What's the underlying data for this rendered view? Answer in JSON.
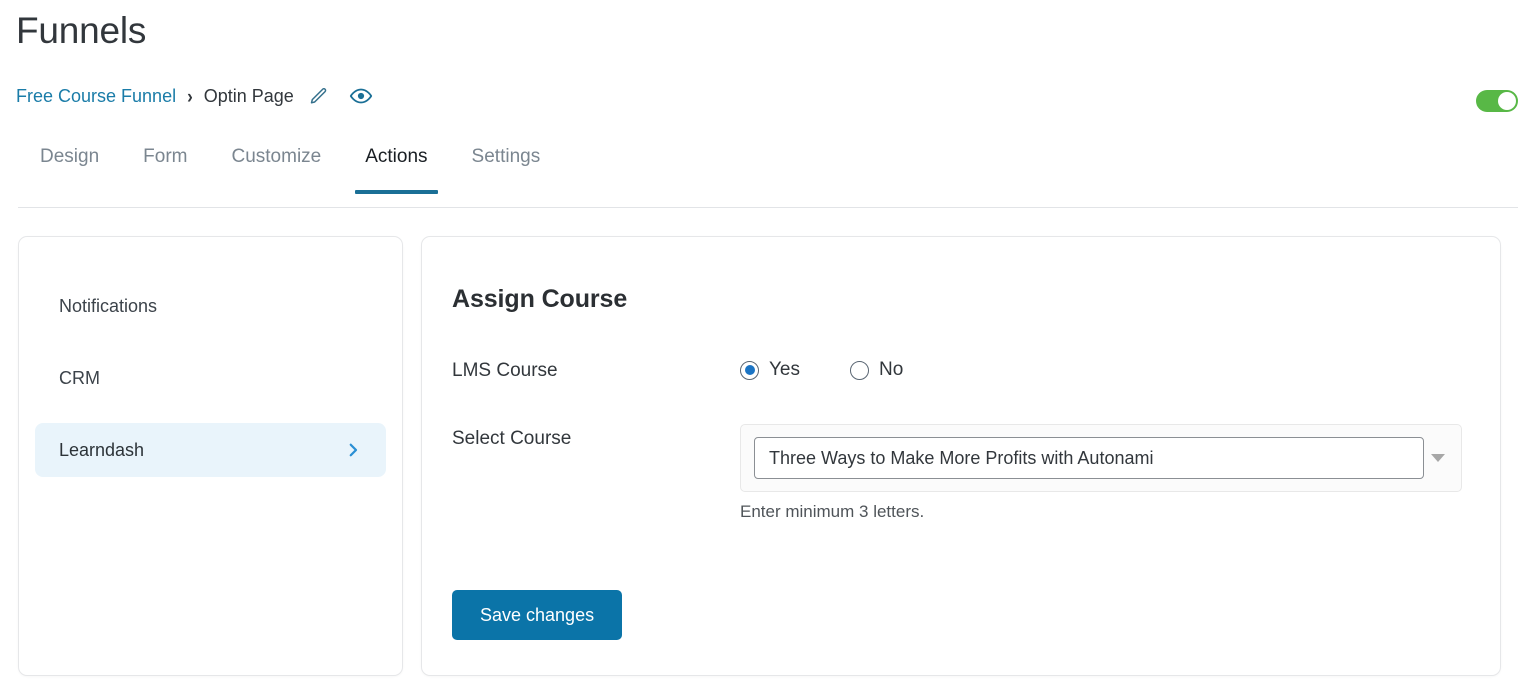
{
  "header": {
    "title": "Funnels",
    "breadcrumb": {
      "parent": "Free Course Funnel",
      "separator": "›",
      "current": "Optin Page",
      "edit_icon": "pencil-icon",
      "preview_icon": "eye-icon"
    },
    "status_toggle": {
      "state": "on",
      "color": "#58b846"
    }
  },
  "tabs": [
    {
      "label": "Design",
      "active": false
    },
    {
      "label": "Form",
      "active": false
    },
    {
      "label": "Customize",
      "active": false
    },
    {
      "label": "Actions",
      "active": true
    },
    {
      "label": "Settings",
      "active": false
    }
  ],
  "sidebar": {
    "items": [
      {
        "label": "Notifications",
        "active": false,
        "chevron": false
      },
      {
        "label": "CRM",
        "active": false,
        "chevron": false
      },
      {
        "label": "Learndash",
        "active": true,
        "chevron": true,
        "chevron_icon": "chevron-right-icon"
      }
    ]
  },
  "main": {
    "section_title": "Assign Course",
    "lms_course": {
      "label": "LMS Course",
      "options": [
        {
          "label": "Yes",
          "selected": true
        },
        {
          "label": "No",
          "selected": false
        }
      ]
    },
    "select_course": {
      "label": "Select Course",
      "value": "Three Ways to Make More Profits with Autonami",
      "placeholder": "Select Course",
      "hint": "Enter minimum 3 letters.",
      "caret_icon": "chevron-down-icon"
    },
    "save_button": "Save changes"
  },
  "colors": {
    "accent": "#1a6f96",
    "link": "#1a7ca8",
    "button": "#0b74a8",
    "radio_selected": "#1b74c4",
    "toggle_on": "#58b846",
    "sidebar_active_bg": "#e9f4fb"
  }
}
